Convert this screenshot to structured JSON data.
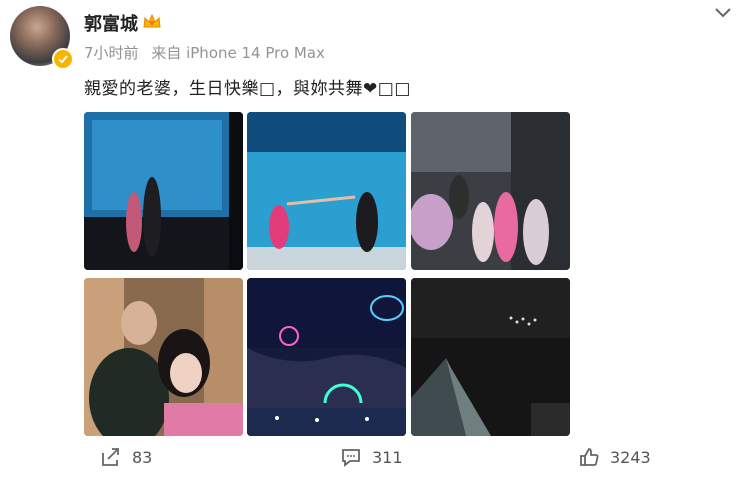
{
  "post": {
    "author": "郭富城",
    "time": "7小时前",
    "source": "来自 iPhone 14 Pro Max",
    "text": "親愛的老婆，生日快樂□，與妳共舞❤□□"
  },
  "photos": [
    {
      "name": "aquarium-couple-back-photo"
    },
    {
      "name": "aquarium-dance-photo"
    },
    {
      "name": "birthday-bouquet-group-photo"
    },
    {
      "name": "couple-selfie-photo"
    },
    {
      "name": "night-drone-show-photo"
    },
    {
      "name": "night-fountain-drones-photo"
    }
  ],
  "actions": {
    "share_count": "83",
    "comment_count": "311",
    "like_count": "3243"
  },
  "colors": {
    "verified_badge": "#f7b500",
    "crown": "#f7b500",
    "meta_text": "#939393"
  },
  "icons": [
    "crown-icon",
    "verified-icon",
    "chevron-down-icon",
    "share-icon",
    "comment-icon",
    "like-icon"
  ]
}
